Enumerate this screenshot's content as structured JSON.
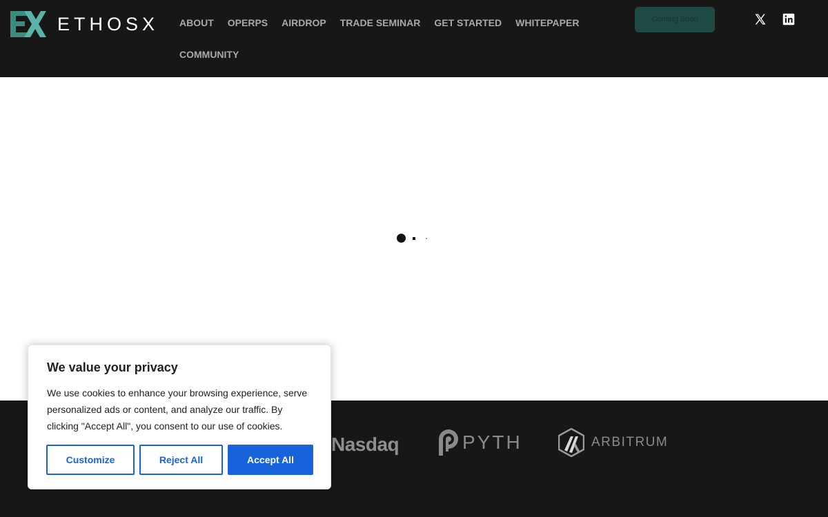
{
  "header": {
    "logo": {
      "text": "ETHOSX",
      "mark": "EX"
    },
    "nav": [
      {
        "label": "ABOUT"
      },
      {
        "label": "OPERPS"
      },
      {
        "label": "AIRDROP"
      },
      {
        "label": "TRADE SEMINAR"
      },
      {
        "label": "GET STARTED"
      },
      {
        "label": "WHITEPAPER"
      },
      {
        "label": "COMMUNITY"
      }
    ],
    "coming_soon_label": "Coming Soon",
    "social": [
      {
        "icon": "x-twitter-icon"
      },
      {
        "icon": "linkedin-icon"
      }
    ]
  },
  "partners": {
    "items": [
      {
        "name": "Nasdaq"
      },
      {
        "name": "PYTH"
      },
      {
        "name": "ARBITRUM"
      }
    ]
  },
  "cookie": {
    "title": "We value your privacy",
    "text": "We use cookies to enhance your browsing experience, serve personalized ads or content, and analyze our traffic. By clicking \"Accept All\", you consent to our use of cookies.",
    "customize_label": "Customize",
    "reject_label": "Reject All",
    "accept_label": "Accept All"
  },
  "colors": {
    "header_bg": "#171717",
    "accent_teal": "#5ab3a6",
    "button_blue": "#1863dc"
  }
}
